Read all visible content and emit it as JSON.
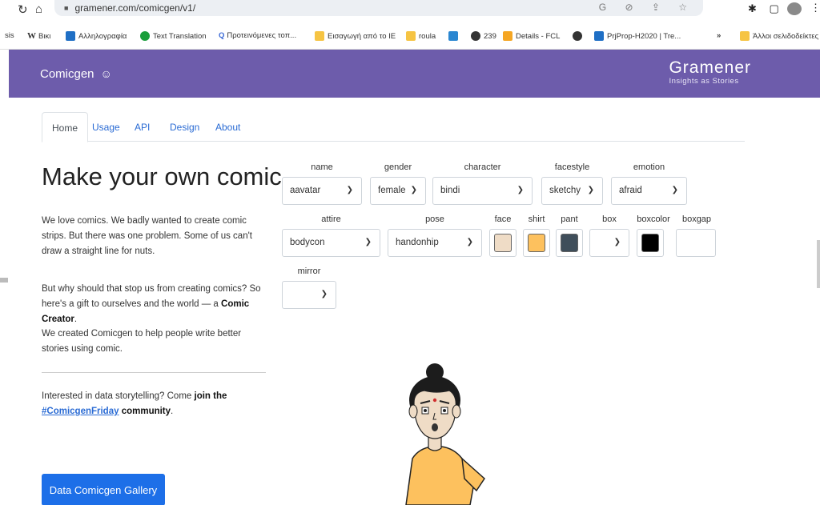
{
  "browser": {
    "url": "gramener.com/comicgen/v1/",
    "bookmarks": [
      {
        "label": "sis",
        "icon": "none"
      },
      {
        "label": "Βικι",
        "icon": "wikipedia-icon"
      },
      {
        "label": "Αλληλογραφία",
        "icon": "outlook-icon"
      },
      {
        "label": "Text Translation",
        "icon": "green-dot-icon"
      },
      {
        "label": "Προτεινόμενες τοπ...",
        "icon": "search-icon"
      },
      {
        "label": "Εισαγωγή από το IE",
        "icon": "folder-icon"
      },
      {
        "label": "roula",
        "icon": "folder-icon"
      },
      {
        "label": "239",
        "icon": "globe-icon"
      },
      {
        "label": "Details - FCL",
        "icon": "people-icon"
      },
      {
        "label": "PrjProp-H2020 | Tre...",
        "icon": "trello-icon"
      },
      {
        "label": "Άλλοι σελιδοδείκτες",
        "icon": "folder-icon"
      }
    ],
    "overflow": "»"
  },
  "header": {
    "brand": "Comicgen",
    "logo_name": "Gramener",
    "logo_tagline": "Insights as Stories"
  },
  "tabs": [
    "Home",
    "Usage",
    "API",
    "Design",
    "About"
  ],
  "main": {
    "headline": "Make your own comic",
    "para1": "We love comics. We badly wanted to create comic strips. But there was one problem. Some of us can't draw a straight line for nuts.",
    "para2_pre": "But why should that stop us from creating comics? So here's a gift to ourselves and the world — a ",
    "para2_bold": "Comic Creator",
    "para2_post": ".",
    "para3": "We created Comicgen to help people write better stories using comic.",
    "para4_pre": "Interested in data storytelling? Come ",
    "para4_bold1": "join the",
    "para4_link": "#ComicgenFriday",
    "para4_bold2": " community",
    "para4_post": ".",
    "gallery_button": "Data Comicgen Gallery"
  },
  "controls": {
    "name": {
      "label": "name",
      "value": "aavatar"
    },
    "gender": {
      "label": "gender",
      "value": "female"
    },
    "character": {
      "label": "character",
      "value": "bindi"
    },
    "facestyle": {
      "label": "facestyle",
      "value": "sketchy"
    },
    "emotion": {
      "label": "emotion",
      "value": "afraid"
    },
    "attire": {
      "label": "attire",
      "value": "bodycon"
    },
    "pose": {
      "label": "pose",
      "value": "handonhip"
    },
    "face": {
      "label": "face",
      "color": "#efdcc6"
    },
    "shirt": {
      "label": "shirt",
      "color": "#fdc15e"
    },
    "pant": {
      "label": "pant",
      "color": "#3f4e5a"
    },
    "box": {
      "label": "box",
      "value": ""
    },
    "boxcolor": {
      "label": "boxcolor",
      "color": "#000000"
    },
    "boxgap": {
      "label": "boxgap",
      "value": ""
    },
    "mirror": {
      "label": "mirror",
      "value": ""
    }
  },
  "colors": {
    "header_bg": "#6d5cab",
    "accent": "#1d6fe8",
    "link": "#2a6bd4"
  }
}
